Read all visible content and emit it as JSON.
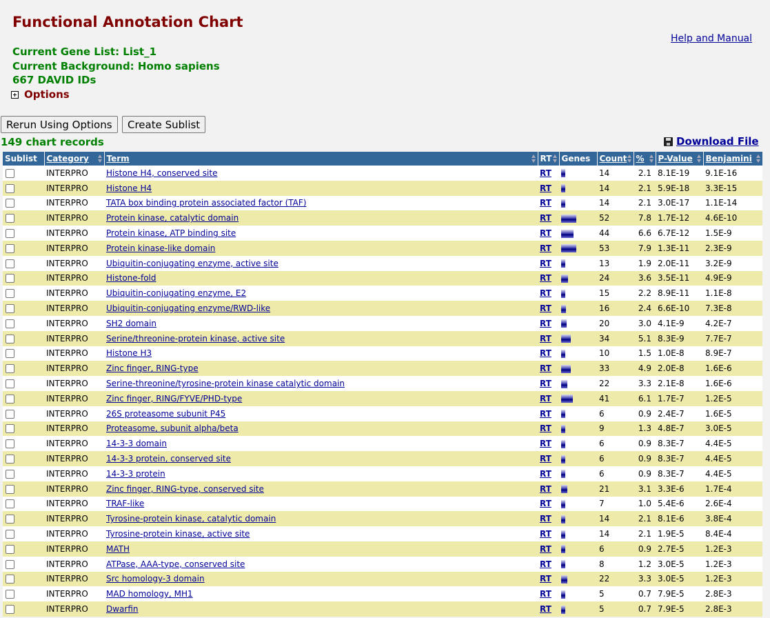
{
  "header": {
    "title": "Functional Annotation Chart",
    "help_link": "Help and Manual",
    "gene_list": "Current Gene List: List_1",
    "background": "Current Background: Homo sapiens",
    "ids": "667 DAVID IDs",
    "options": "Options"
  },
  "buttons": {
    "rerun": "Rerun Using Options",
    "sublist": "Create Sublist"
  },
  "records": "149 chart records",
  "download": "Download File",
  "table": {
    "columns": [
      "Sublist",
      "Category",
      "Term",
      "RT",
      "Genes",
      "Count",
      "%",
      "P-Value",
      "Benjamini"
    ],
    "rows": [
      {
        "category": "INTERPRO",
        "term": "Histone H4, conserved site",
        "rt": "RT",
        "count": "14",
        "pct": "2.1",
        "p": "8.1E-19",
        "b": "9.1E-16"
      },
      {
        "category": "INTERPRO",
        "term": "Histone H4",
        "rt": "RT",
        "count": "14",
        "pct": "2.1",
        "p": "5.9E-18",
        "b": "3.3E-15"
      },
      {
        "category": "INTERPRO",
        "term": "TATA box binding protein associated factor (TAF)",
        "rt": "RT",
        "count": "14",
        "pct": "2.1",
        "p": "3.0E-17",
        "b": "1.1E-14"
      },
      {
        "category": "INTERPRO",
        "term": "Protein kinase, catalytic domain",
        "rt": "RT",
        "count": "52",
        "pct": "7.8",
        "p": "1.7E-12",
        "b": "4.6E-10"
      },
      {
        "category": "INTERPRO",
        "term": "Protein kinase, ATP binding site",
        "rt": "RT",
        "count": "44",
        "pct": "6.6",
        "p": "6.7E-12",
        "b": "1.5E-9"
      },
      {
        "category": "INTERPRO",
        "term": "Protein kinase-like domain",
        "rt": "RT",
        "count": "53",
        "pct": "7.9",
        "p": "1.3E-11",
        "b": "2.3E-9"
      },
      {
        "category": "INTERPRO",
        "term": "Ubiquitin-conjugating enzyme, active site",
        "rt": "RT",
        "count": "13",
        "pct": "1.9",
        "p": "2.0E-11",
        "b": "3.2E-9"
      },
      {
        "category": "INTERPRO",
        "term": "Histone-fold",
        "rt": "RT",
        "count": "24",
        "pct": "3.6",
        "p": "3.5E-11",
        "b": "4.9E-9"
      },
      {
        "category": "INTERPRO",
        "term": "Ubiquitin-conjugating enzyme, E2",
        "rt": "RT",
        "count": "15",
        "pct": "2.2",
        "p": "8.9E-11",
        "b": "1.1E-8"
      },
      {
        "category": "INTERPRO",
        "term": "Ubiquitin-conjugating enzyme/RWD-like",
        "rt": "RT",
        "count": "16",
        "pct": "2.4",
        "p": "6.6E-10",
        "b": "7.3E-8"
      },
      {
        "category": "INTERPRO",
        "term": "SH2 domain",
        "rt": "RT",
        "count": "20",
        "pct": "3.0",
        "p": "4.1E-9",
        "b": "4.2E-7"
      },
      {
        "category": "INTERPRO",
        "term": "Serine/threonine-protein kinase, active site",
        "rt": "RT",
        "count": "34",
        "pct": "5.1",
        "p": "8.3E-9",
        "b": "7.7E-7"
      },
      {
        "category": "INTERPRO",
        "term": "Histone H3",
        "rt": "RT",
        "count": "10",
        "pct": "1.5",
        "p": "1.0E-8",
        "b": "8.9E-7"
      },
      {
        "category": "INTERPRO",
        "term": "Zinc finger, RING-type",
        "rt": "RT",
        "count": "33",
        "pct": "4.9",
        "p": "2.0E-8",
        "b": "1.6E-6"
      },
      {
        "category": "INTERPRO",
        "term": "Serine-threonine/tyrosine-protein kinase catalytic domain",
        "rt": "RT",
        "count": "22",
        "pct": "3.3",
        "p": "2.1E-8",
        "b": "1.6E-6"
      },
      {
        "category": "INTERPRO",
        "term": "Zinc finger, RING/FYVE/PHD-type",
        "rt": "RT",
        "count": "41",
        "pct": "6.1",
        "p": "1.7E-7",
        "b": "1.2E-5"
      },
      {
        "category": "INTERPRO",
        "term": "26S proteasome subunit P45",
        "rt": "RT",
        "count": "6",
        "pct": "0.9",
        "p": "2.4E-7",
        "b": "1.6E-5"
      },
      {
        "category": "INTERPRO",
        "term": "Proteasome, subunit alpha/beta",
        "rt": "RT",
        "count": "9",
        "pct": "1.3",
        "p": "4.8E-7",
        "b": "3.0E-5"
      },
      {
        "category": "INTERPRO",
        "term": "14-3-3 domain",
        "rt": "RT",
        "count": "6",
        "pct": "0.9",
        "p": "8.3E-7",
        "b": "4.4E-5"
      },
      {
        "category": "INTERPRO",
        "term": "14-3-3 protein, conserved site",
        "rt": "RT",
        "count": "6",
        "pct": "0.9",
        "p": "8.3E-7",
        "b": "4.4E-5"
      },
      {
        "category": "INTERPRO",
        "term": "14-3-3 protein",
        "rt": "RT",
        "count": "6",
        "pct": "0.9",
        "p": "8.3E-7",
        "b": "4.4E-5"
      },
      {
        "category": "INTERPRO",
        "term": "Zinc finger, RING-type, conserved site",
        "rt": "RT",
        "count": "21",
        "pct": "3.1",
        "p": "3.3E-6",
        "b": "1.7E-4"
      },
      {
        "category": "INTERPRO",
        "term": "TRAF-like",
        "rt": "RT",
        "count": "7",
        "pct": "1.0",
        "p": "5.4E-6",
        "b": "2.6E-4"
      },
      {
        "category": "INTERPRO",
        "term": "Tyrosine-protein kinase, catalytic domain",
        "rt": "RT",
        "count": "14",
        "pct": "2.1",
        "p": "8.1E-6",
        "b": "3.8E-4"
      },
      {
        "category": "INTERPRO",
        "term": "Tyrosine-protein kinase, active site",
        "rt": "RT",
        "count": "14",
        "pct": "2.1",
        "p": "1.9E-5",
        "b": "8.4E-4"
      },
      {
        "category": "INTERPRO",
        "term": "MATH",
        "rt": "RT",
        "count": "6",
        "pct": "0.9",
        "p": "2.7E-5",
        "b": "1.2E-3"
      },
      {
        "category": "INTERPRO",
        "term": "ATPase, AAA-type, conserved site",
        "rt": "RT",
        "count": "8",
        "pct": "1.2",
        "p": "3.0E-5",
        "b": "1.2E-3"
      },
      {
        "category": "INTERPRO",
        "term": "Src homology-3 domain",
        "rt": "RT",
        "count": "22",
        "pct": "3.3",
        "p": "3.0E-5",
        "b": "1.2E-3"
      },
      {
        "category": "INTERPRO",
        "term": "MAD homology, MH1",
        "rt": "RT",
        "count": "5",
        "pct": "0.7",
        "p": "7.9E-5",
        "b": "2.8E-3"
      },
      {
        "category": "INTERPRO",
        "term": "Dwarfin",
        "rt": "RT",
        "count": "5",
        "pct": "0.7",
        "p": "7.9E-5",
        "b": "2.8E-3"
      }
    ]
  },
  "colors": {
    "title": "#800000",
    "info": "#008000",
    "header_bg": "#336699",
    "row_alt": "#eeeaaa",
    "link": "#000099"
  }
}
